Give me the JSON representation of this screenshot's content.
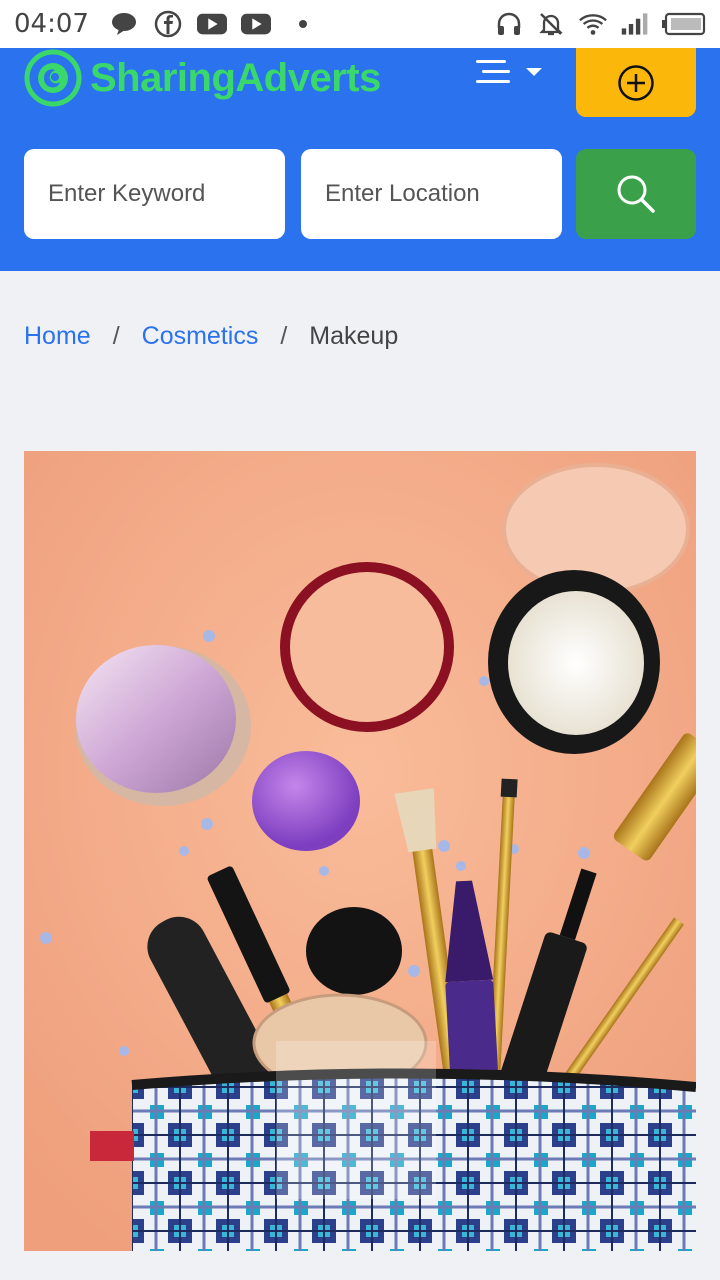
{
  "status_bar": {
    "time": "04:07"
  },
  "header": {
    "brand": "SharingAdverts",
    "keyword_placeholder": "Enter Keyword",
    "location_placeholder": "Enter Location"
  },
  "breadcrumb": {
    "items": [
      "Home",
      "Cosmetics",
      "Makeup"
    ],
    "separator": "/"
  },
  "colors": {
    "header_bg": "#2a72ee",
    "add_button": "#fbb80b",
    "search_button": "#3aa14a",
    "brand_text": "#3ad86b",
    "link": "#2a72ee"
  }
}
